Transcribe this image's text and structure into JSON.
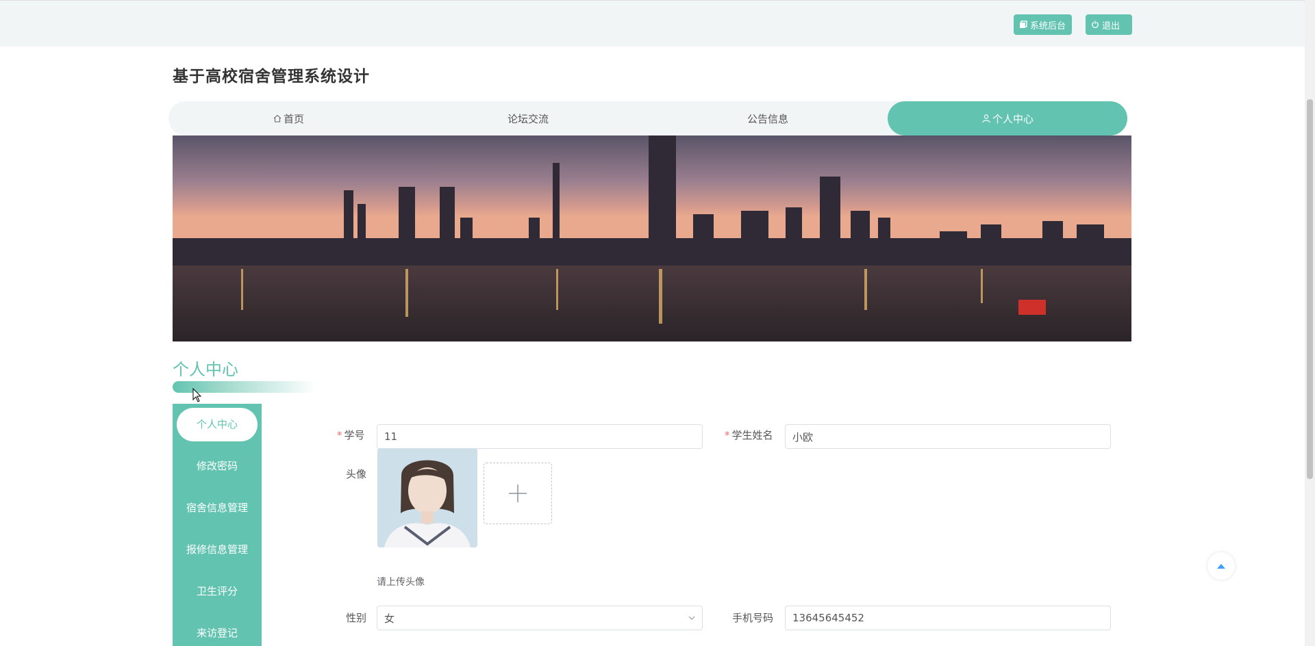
{
  "header": {
    "admin_label": "系统后台",
    "logout_label": "退出"
  },
  "site": {
    "title": "基于高校宿舍管理系统设计"
  },
  "nav": {
    "items": [
      {
        "label": "首页",
        "icon": "home-icon"
      },
      {
        "label": "论坛交流",
        "icon": ""
      },
      {
        "label": "公告信息",
        "icon": ""
      },
      {
        "label": "个人中心",
        "icon": "user-icon",
        "active": true
      }
    ]
  },
  "section": {
    "title": "个人中心"
  },
  "sidemenu": {
    "items": [
      {
        "label": "个人中心",
        "active": true
      },
      {
        "label": "修改密码"
      },
      {
        "label": "宿舍信息管理"
      },
      {
        "label": "报修信息管理"
      },
      {
        "label": "卫生评分"
      },
      {
        "label": "来访登记"
      }
    ]
  },
  "form": {
    "student_id_label": "学号",
    "student_id_value": "11",
    "student_name_label": "学生姓名",
    "student_name_value": "小欧",
    "avatar_label": "头像",
    "avatar_hint": "请上传头像",
    "gender_label": "性别",
    "gender_value": "女",
    "phone_label": "手机号码",
    "phone_value": "13645645452"
  },
  "colors": {
    "accent": "#62c4b0",
    "required": "#f56c6c"
  }
}
